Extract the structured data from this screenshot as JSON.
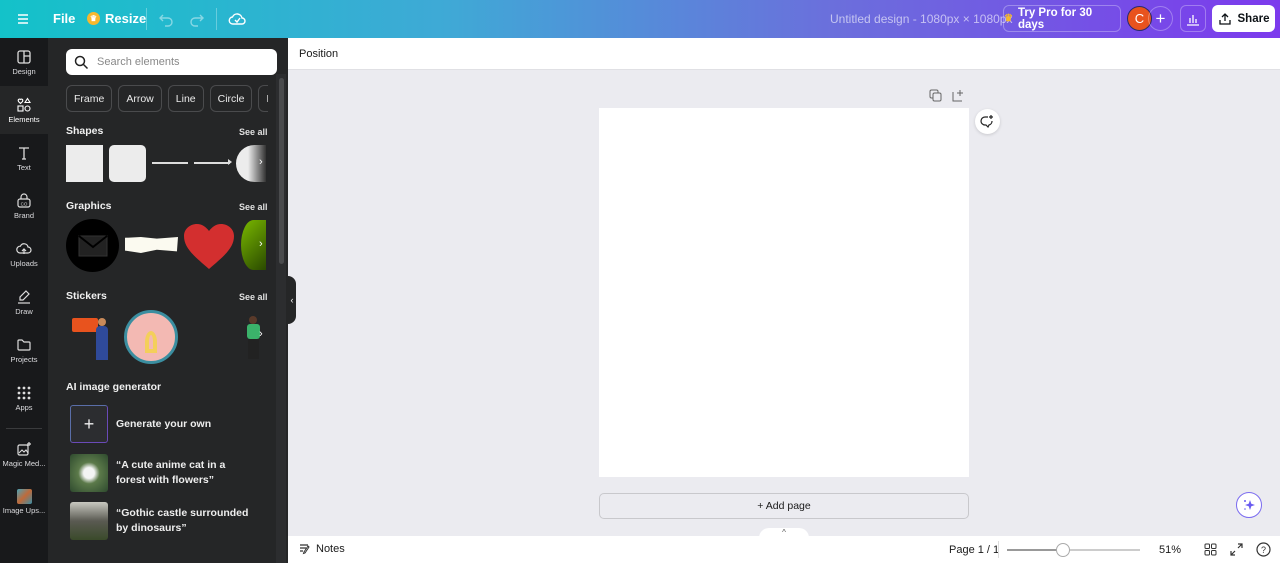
{
  "topbar": {
    "file_label": "File",
    "resize_label": "Resize",
    "design_title": "Untitled design - 1080px × 1080px",
    "try_pro_label": "Try Pro for 30 days",
    "avatar_initial": "C",
    "share_label": "Share"
  },
  "rail": {
    "items": [
      {
        "label": "Design",
        "icon": "layout-icon"
      },
      {
        "label": "Elements",
        "icon": "shapes-icon",
        "active": true
      },
      {
        "label": "Text",
        "icon": "text-icon"
      },
      {
        "label": "Brand",
        "icon": "brand-icon"
      },
      {
        "label": "Uploads",
        "icon": "cloud-upload-icon"
      },
      {
        "label": "Draw",
        "icon": "pen-icon"
      },
      {
        "label": "Projects",
        "icon": "folder-icon"
      },
      {
        "label": "Apps",
        "icon": "grid-icon"
      },
      {
        "label": "Magic Med...",
        "icon": "magic-media-icon"
      },
      {
        "label": "Image Ups...",
        "icon": "image-upscaler-icon"
      }
    ]
  },
  "panel": {
    "search_placeholder": "Search elements",
    "chips": [
      "Frame",
      "Arrow",
      "Line",
      "Circle",
      "D"
    ],
    "sections": {
      "shapes": {
        "title": "Shapes",
        "see_all": "See all"
      },
      "graphics": {
        "title": "Graphics",
        "see_all": "See all"
      },
      "stickers": {
        "title": "Stickers",
        "see_all": "See all"
      },
      "ai": {
        "title": "AI image generator"
      }
    },
    "ai_items": [
      {
        "label": "Generate your own"
      },
      {
        "label": "“A cute anime cat in a forest with flowers”"
      },
      {
        "label": "“Gothic castle surrounded by dinosaurs”"
      }
    ]
  },
  "context_bar": {
    "position_label": "Position"
  },
  "canvas": {
    "add_page_label": "+ Add page"
  },
  "bottom": {
    "notes_label": "Notes",
    "page_indicator": "Page 1 / 1",
    "zoom_percent": "51%",
    "zoom_value": 51
  },
  "colors": {
    "accent_purple": "#7c3aed",
    "accent_teal": "#13c2c9",
    "avatar_bg": "#e8531e",
    "panel_bg": "#252627",
    "rail_bg": "#18191b"
  }
}
